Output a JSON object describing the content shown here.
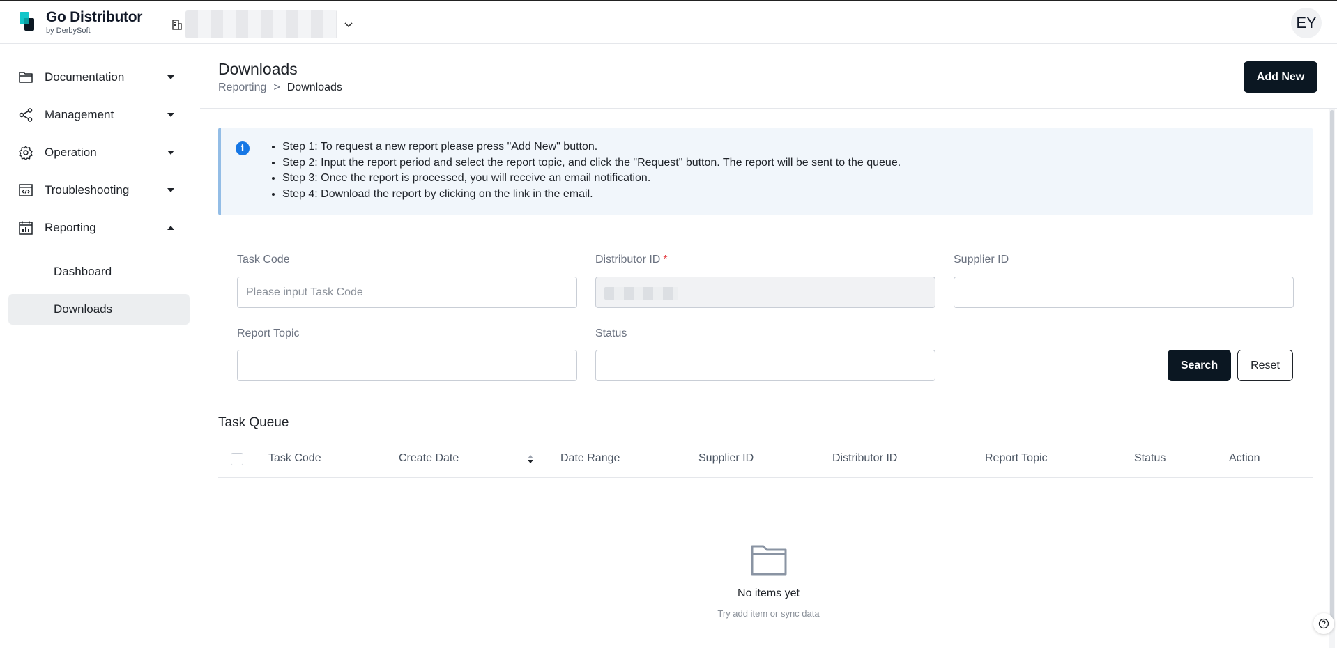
{
  "header": {
    "brand_name": "Go Distributor",
    "brand_sub": "by DerbySoft",
    "org_name": "",
    "avatar_initials": "EY"
  },
  "sidebar": {
    "items": [
      {
        "label": "Documentation",
        "icon": "folder-icon",
        "expanded": false
      },
      {
        "label": "Management",
        "icon": "share-icon",
        "expanded": false
      },
      {
        "label": "Operation",
        "icon": "gear-icon",
        "expanded": false
      },
      {
        "label": "Troubleshooting",
        "icon": "code-window-icon",
        "expanded": false
      },
      {
        "label": "Reporting",
        "icon": "report-chart-icon",
        "expanded": true
      }
    ],
    "sub_items": [
      {
        "label": "Dashboard",
        "active": false
      },
      {
        "label": "Downloads",
        "active": true
      }
    ]
  },
  "page": {
    "title": "Downloads",
    "breadcrumb": {
      "parent": "Reporting",
      "separator": ">",
      "current": "Downloads"
    },
    "add_new_label": "Add New"
  },
  "info": {
    "steps": [
      "Step 1: To request a new report please press \"Add New\" button.",
      "Step 2: Input the report period and select the report topic, and click the \"Request\" button. The report will be sent to the queue.",
      "Step 3: Once the report is processed, you will receive an email notification.",
      "Step 4: Download the report by clicking on the link in the email."
    ]
  },
  "filters": {
    "task_code": {
      "label": "Task Code",
      "placeholder": "Please input Task Code",
      "value": ""
    },
    "distributor_id": {
      "label": "Distributor ID",
      "required_mark": "*",
      "value": ""
    },
    "supplier_id": {
      "label": "Supplier ID",
      "value": ""
    },
    "report_topic": {
      "label": "Report Topic",
      "value": ""
    },
    "status": {
      "label": "Status",
      "value": ""
    },
    "search_label": "Search",
    "reset_label": "Reset"
  },
  "table": {
    "title": "Task Queue",
    "columns": [
      "Task Code",
      "Create Date",
      "Date Range",
      "Supplier ID",
      "Distributor ID",
      "Report Topic",
      "Status",
      "Action"
    ],
    "rows": [],
    "empty_title": "No items yet",
    "empty_sub": "Try add item or sync data"
  },
  "colors": {
    "primary_button": "#0b1722",
    "info_background": "#f1f6fb",
    "info_accent": "#93bde6",
    "info_icon": "#1677e5",
    "required": "#e5484d",
    "active_nav": "#eceef0"
  }
}
